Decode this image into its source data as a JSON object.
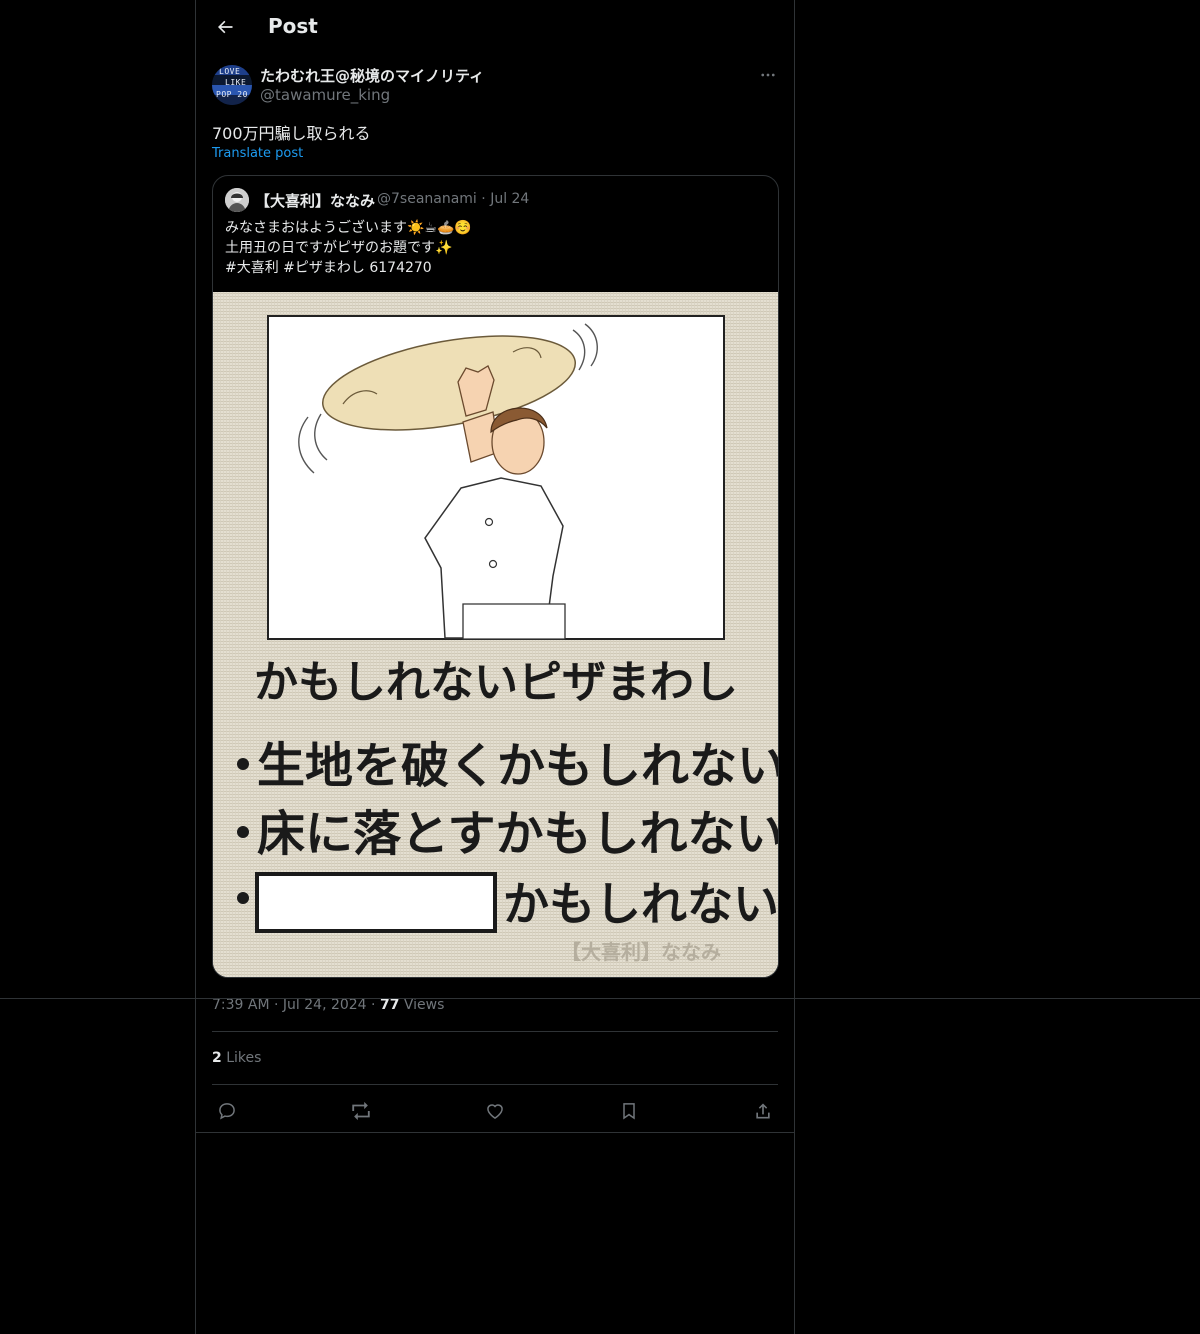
{
  "header": {
    "title": "Post"
  },
  "post": {
    "author": {
      "display_name": "たわむれ王@秘境のマイノリティ",
      "handle": "@tawamure_king",
      "avatar_text": [
        "LOVE",
        "LIKE",
        "POP 20"
      ]
    },
    "text": "700万円騙し取られる",
    "translate_label": "Translate post",
    "quoted": {
      "author_name": "【大喜利】ななみ",
      "handle": "@7seananami",
      "date": "Jul 24",
      "lines": [
        "みなさまおはようございます☀️☕🥧☺️",
        "土用丑の日ですがピザのお題です✨",
        "#大喜利 #ピザまわし 6174270"
      ],
      "image": {
        "title": "かもしれないピザまわし",
        "bullets": [
          "生地を破くかもしれない",
          "床に落とすかもしれない"
        ],
        "blank_suffix": "かもしれない",
        "watermark": "【大喜利】ななみ"
      }
    },
    "time": "7:39 AM",
    "date": "Jul 24, 2024",
    "views_count": "77",
    "views_label": "Views",
    "likes_count": "2",
    "likes_label": "Likes"
  },
  "icons": [
    "back-arrow-icon",
    "more-icon",
    "reply-icon",
    "repost-icon",
    "like-icon",
    "bookmark-icon",
    "share-icon"
  ],
  "colors": {
    "background": "#000000",
    "text": "#e7e9ea",
    "muted": "#71767b",
    "link": "#1d9bf0",
    "border": "#2f3336"
  }
}
